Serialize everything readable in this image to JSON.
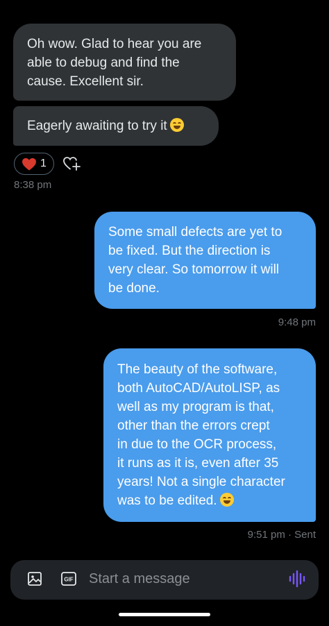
{
  "messages": [
    {
      "direction": "received",
      "text": "Oh wow.  Glad to hear you are\nable to debug and find the\ncause. Excellent sir."
    },
    {
      "direction": "received",
      "text": "Eagerly awaiting to try it",
      "emoji": "smiling-face-icon"
    },
    {
      "direction": "sent",
      "text": "Some small defects are yet to\nbe fixed. But the direction is\nvery clear. So tomorrow it will\nbe done."
    },
    {
      "direction": "sent",
      "text": "The beauty of the software,\nboth AutoCAD/AutoLISP, as\nwell as my program is that,\nother than the errors crept\nin due to the OCR process,\nit runs as it is, even after 35\nyears! Not a single character\nwas to be edited.",
      "emoji": "grinning-face-icon"
    }
  ],
  "reaction": {
    "icon": "red-heart-icon",
    "count": "1"
  },
  "timestamps": {
    "received": "8:38 pm",
    "sent_first": "9:48 pm",
    "sent_last": "9:51 pm · Sent"
  },
  "composer": {
    "placeholder": "Start a message",
    "gif_label": "GIF",
    "accent_color": "#7856ff"
  },
  "colors": {
    "background": "#000000",
    "received_bubble": "#2f3336",
    "sent_bubble": "#4a9cec"
  }
}
